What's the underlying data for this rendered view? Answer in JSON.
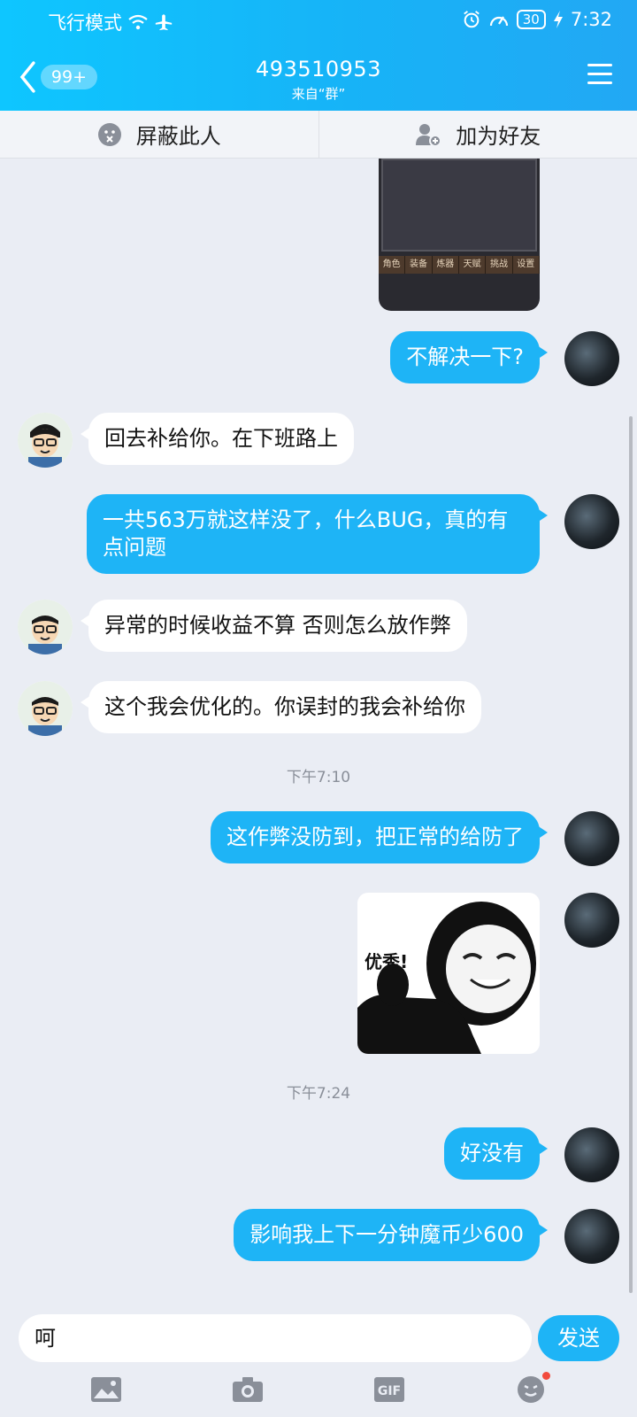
{
  "status_bar": {
    "left_text": "飞行模式",
    "time": "7:32",
    "battery": "30"
  },
  "header": {
    "badge": "99+",
    "title": "493510953",
    "subtitle": "来自“群”"
  },
  "actions": {
    "block": "屏蔽此人",
    "add_friend": "加为好友"
  },
  "game_image": {
    "tabs": [
      "角色",
      "装备",
      "炼器",
      "天赋",
      "挑战",
      "设置"
    ]
  },
  "messages": [
    {
      "side": "me",
      "text": "不解决一下?"
    },
    {
      "side": "them",
      "text": "回去补给你。在下班路上"
    },
    {
      "side": "me",
      "text": "一共563万就这样没了，什么BUG，真的有点问题"
    },
    {
      "side": "them",
      "text": "异常的时候收益不算 否则怎么放作弊"
    },
    {
      "side": "them",
      "text": "这个我会优化的。你误封的我会补给你"
    },
    {
      "side": "me",
      "text": "这作弊没防到，把正常的给防了"
    },
    {
      "side": "me",
      "text": "好没有"
    },
    {
      "side": "me",
      "text": "影响我上下一分钟魔币少600"
    }
  ],
  "timestamps": [
    "下午7:10",
    "下午7:24"
  ],
  "sticker": {
    "caption": "优秀!"
  },
  "input": {
    "value": "呵",
    "send_label": "发送"
  },
  "toolbar": {
    "icons": [
      "image-icon",
      "camera-icon",
      "gif-icon",
      "emoji-icon"
    ],
    "gif_label": "GIF"
  },
  "colors": {
    "accent": "#1eb4f6",
    "background": "#eaedf4"
  }
}
